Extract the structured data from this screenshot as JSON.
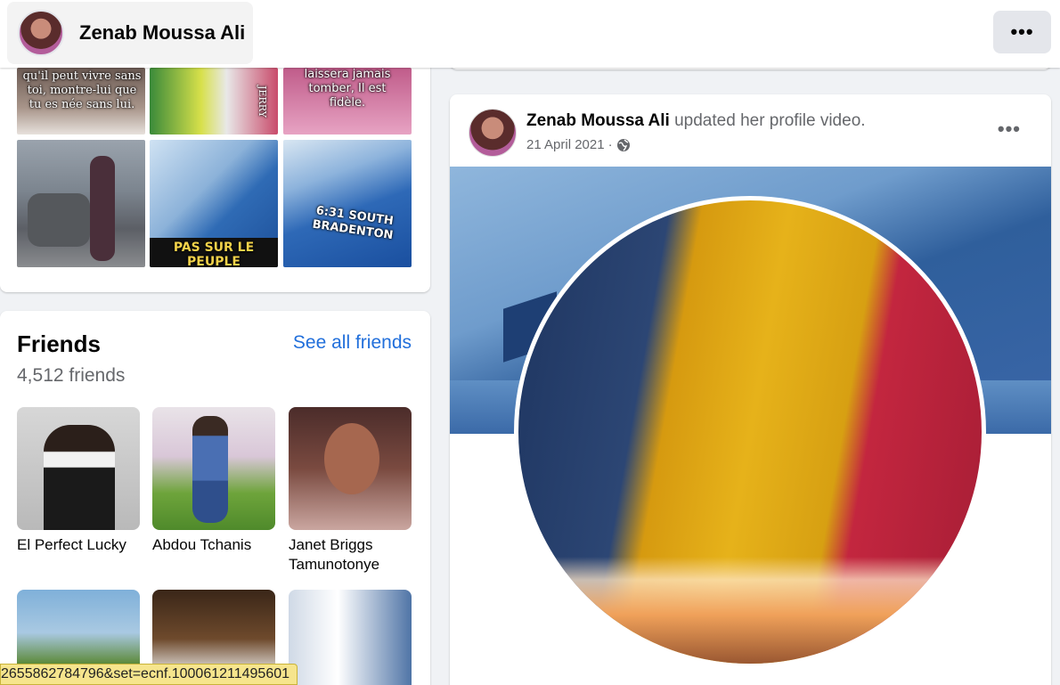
{
  "topbar": {
    "profile_name": "Zenab Moussa Ali",
    "more_label": "•••"
  },
  "photos": {
    "tiles": [
      {
        "caption": "qu'il peut vivre sans toi, montre-lui que tu es née sans lui."
      },
      {
        "caption": "JERRY"
      },
      {
        "caption": "laissera jamais tomber, Il est fidèle."
      },
      {
        "caption": ""
      },
      {
        "caption": "PAS SUR LE PEUPLE"
      },
      {
        "caption": "6:31 SOUTH BRADENTON"
      }
    ]
  },
  "friends": {
    "title": "Friends",
    "see_all": "See all friends",
    "count": "4,512 friends",
    "items": [
      {
        "name": "El Perfect Lucky"
      },
      {
        "name": "Abdou Tchanis"
      },
      {
        "name": "Janet Briggs Tamunotonye"
      },
      {
        "name": ""
      },
      {
        "name": ""
      },
      {
        "name": ""
      }
    ]
  },
  "post": {
    "author": "Zenab Moussa Ali",
    "action": "updated her profile video.",
    "date": "21 April 2021",
    "separator": "·",
    "privacy_icon": "globe-icon",
    "more_label": "•••"
  },
  "status_url": "2655862784796&set=ecnf.100061211495601"
}
